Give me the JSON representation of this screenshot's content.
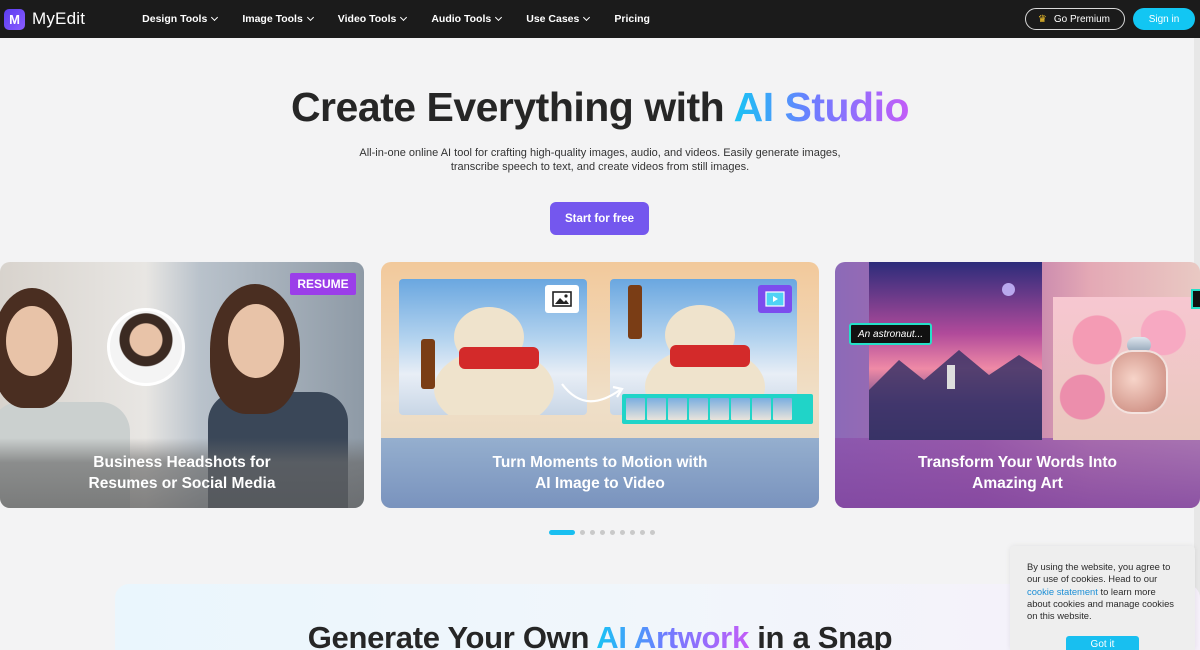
{
  "nav": {
    "logo_mark": "M",
    "logo_text": "MyEdit",
    "menu": [
      {
        "label": "Design Tools"
      },
      {
        "label": "Image Tools"
      },
      {
        "label": "Video Tools"
      },
      {
        "label": "Audio Tools"
      },
      {
        "label": "Use Cases"
      },
      {
        "label": "Pricing"
      }
    ],
    "premium_label": "Go Premium",
    "signin_label": "Sign in"
  },
  "hero": {
    "title_plain": "Create Everything with ",
    "title_gradient": "AI Studio",
    "subtitle_line1": "All-in-one online AI tool for crafting high-quality images, audio, and videos. Easily generate images,",
    "subtitle_line2": "transcribe speech to text, and create videos from still images.",
    "cta_label": "Start for free"
  },
  "carousel": {
    "cards": [
      {
        "badge": "RESUME",
        "caption_line1": "Business Headshots for",
        "caption_line2": "Resumes or Social Media"
      },
      {
        "caption_line1": "Turn Moments to Motion with",
        "caption_line2": "AI Image to Video"
      },
      {
        "prompt_tag": "An astronaut...",
        "caption_line1": "Transform Your Words Into",
        "caption_line2": "Amazing Art"
      }
    ],
    "total_slides": 9,
    "active_slide": 1
  },
  "section2": {
    "title_before": "Generate Your Own ",
    "title_gradient": "AI Artwork",
    "title_after": " in a Snap"
  },
  "cookie": {
    "text_before": "By using the website, you agree to our use of cookies. Head to our ",
    "link_label": "cookie statement",
    "text_after": " to learn more about cookies and manage cookies on this website.",
    "button_label": "Got it"
  },
  "colors": {
    "accent_purple": "#7457ee",
    "accent_cyan": "#12c6f3",
    "nav_bg": "#1b1b1b"
  }
}
